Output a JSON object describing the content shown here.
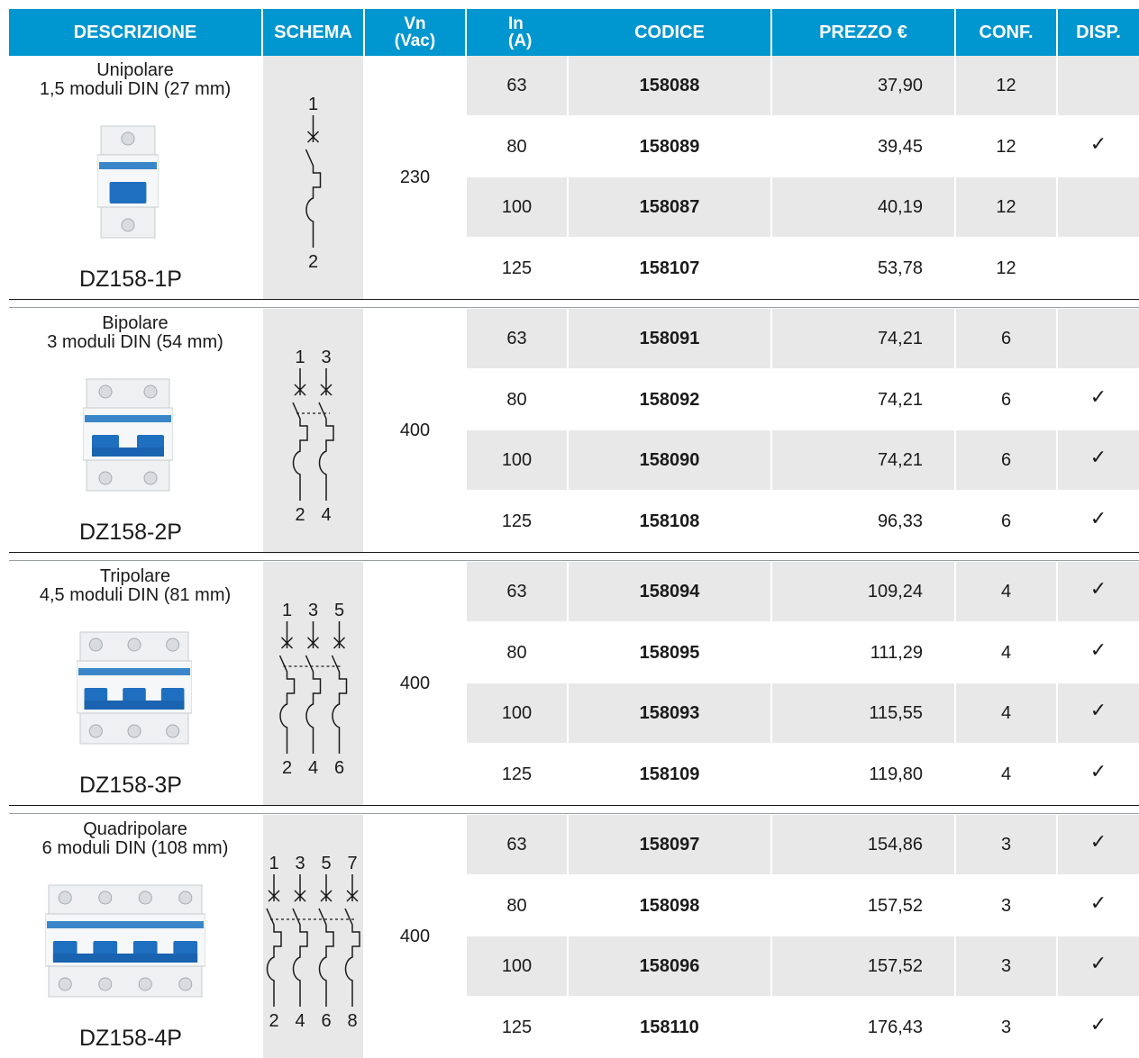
{
  "headers": {
    "descrizione": "DESCRIZIONE",
    "schema": "SCHEMA",
    "vn_line1": "Vn",
    "vn_line2": "(Vac)",
    "in_line1": "In",
    "in_line2": "(A)",
    "codice": "CODICE",
    "prezzo": "PREZZO €",
    "conf": "CONF.",
    "disp": "DISP."
  },
  "colors": {
    "header_bg": "#0096cf",
    "header_text": "#ffffff",
    "stripe": "#e8e8e8"
  },
  "groups": [
    {
      "name": "Unipolare",
      "modules": "1,5 moduli DIN (27 mm)",
      "model": "DZ158-1P",
      "vn": "230",
      "schema_top": [
        "1"
      ],
      "schema_bottom": [
        "2"
      ],
      "image_icon": "breaker-1p-icon",
      "rows": [
        {
          "in": "63",
          "code": "158088",
          "price": "37,90",
          "conf": "12",
          "disp": ""
        },
        {
          "in": "80",
          "code": "158089",
          "price": "39,45",
          "conf": "12",
          "disp": "✓"
        },
        {
          "in": "100",
          "code": "158087",
          "price": "40,19",
          "conf": "12",
          "disp": ""
        },
        {
          "in": "125",
          "code": "158107",
          "price": "53,78",
          "conf": "12",
          "disp": ""
        }
      ]
    },
    {
      "name": "Bipolare",
      "modules": "3 moduli DIN (54 mm)",
      "model": "DZ158-2P",
      "vn": "400",
      "schema_top": [
        "1",
        "3"
      ],
      "schema_bottom": [
        "2",
        "4"
      ],
      "image_icon": "breaker-2p-icon",
      "rows": [
        {
          "in": "63",
          "code": "158091",
          "price": "74,21",
          "conf": "6",
          "disp": ""
        },
        {
          "in": "80",
          "code": "158092",
          "price": "74,21",
          "conf": "6",
          "disp": "✓"
        },
        {
          "in": "100",
          "code": "158090",
          "price": "74,21",
          "conf": "6",
          "disp": "✓"
        },
        {
          "in": "125",
          "code": "158108",
          "price": "96,33",
          "conf": "6",
          "disp": "✓"
        }
      ]
    },
    {
      "name": "Tripolare",
      "modules": "4,5 moduli DIN (81 mm)",
      "model": "DZ158-3P",
      "vn": "400",
      "schema_top": [
        "1",
        "3",
        "5"
      ],
      "schema_bottom": [
        "2",
        "4",
        "6"
      ],
      "image_icon": "breaker-3p-icon",
      "rows": [
        {
          "in": "63",
          "code": "158094",
          "price": "109,24",
          "conf": "4",
          "disp": "✓"
        },
        {
          "in": "80",
          "code": "158095",
          "price": "111,29",
          "conf": "4",
          "disp": "✓"
        },
        {
          "in": "100",
          "code": "158093",
          "price": "115,55",
          "conf": "4",
          "disp": "✓"
        },
        {
          "in": "125",
          "code": "158109",
          "price": "119,80",
          "conf": "4",
          "disp": "✓"
        }
      ]
    },
    {
      "name": "Quadripolare",
      "modules": "6 moduli DIN (108 mm)",
      "model": "DZ158-4P",
      "vn": "400",
      "schema_top": [
        "1",
        "3",
        "5",
        "7"
      ],
      "schema_bottom": [
        "2",
        "4",
        "6",
        "8"
      ],
      "image_icon": "breaker-4p-icon",
      "rows": [
        {
          "in": "63",
          "code": "158097",
          "price": "154,86",
          "conf": "3",
          "disp": "✓"
        },
        {
          "in": "80",
          "code": "158098",
          "price": "157,52",
          "conf": "3",
          "disp": "✓"
        },
        {
          "in": "100",
          "code": "158096",
          "price": "157,52",
          "conf": "3",
          "disp": "✓"
        },
        {
          "in": "125",
          "code": "158110",
          "price": "176,43",
          "conf": "3",
          "disp": "✓"
        }
      ]
    }
  ]
}
